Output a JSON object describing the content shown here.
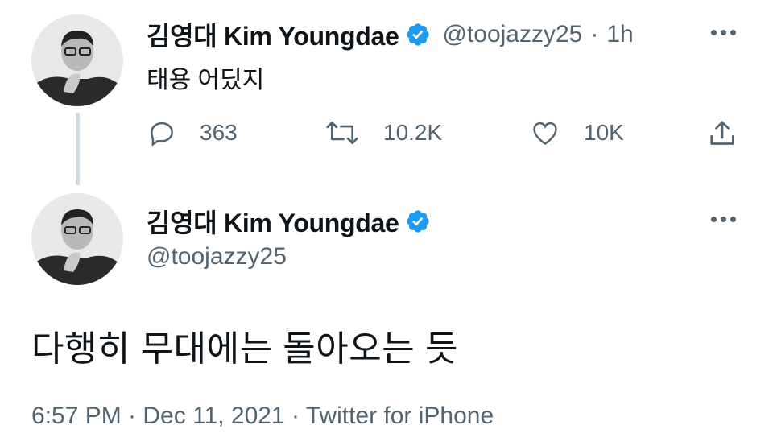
{
  "tweet1": {
    "display_name": "김영대 Kim Youngdae",
    "handle": "@toojazzy25",
    "separator": "·",
    "time": "1h",
    "text": "태용 어딨지",
    "replies": "363",
    "retweets": "10.2K",
    "likes": "10K"
  },
  "tweet2": {
    "display_name": "김영대 Kim Youngdae",
    "handle": "@toojazzy25",
    "text": "다행히 무대에는 돌아오는 듯",
    "timestamp": "6:57 PM · Dec 11, 2021 · Twitter for iPhone"
  },
  "colors": {
    "verified": "#1d9bf0",
    "secondary_text": "#536471",
    "thread_line": "#cfd9de"
  },
  "icons": [
    "verified-badge-icon",
    "more-icon",
    "reply-icon",
    "retweet-icon",
    "like-icon",
    "share-icon"
  ]
}
